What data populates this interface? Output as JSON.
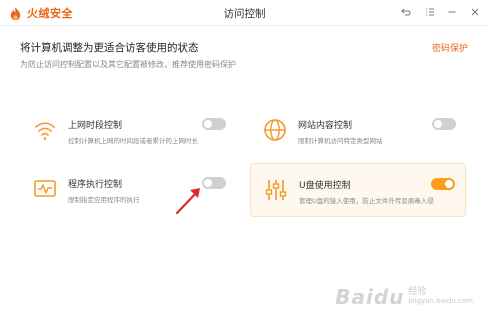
{
  "app": {
    "logo_text": "火绒安全",
    "window_title": "访问控制"
  },
  "header": {
    "title": "将计算机调整为更适合访客使用的状态",
    "subtitle": "为防止访问控制配置以及其它配置被修改，推荐使用密码保护",
    "password_link": "密码保护"
  },
  "cards": [
    {
      "title": "上网时段控制",
      "desc": "控制计算机上网的时间段或者累计的上网时长",
      "icon": "wifi-icon",
      "enabled": false
    },
    {
      "title": "网站内容控制",
      "desc": "限制计算机访问特定类型网站",
      "icon": "globe-icon",
      "enabled": false
    },
    {
      "title": "程序执行控制",
      "desc": "限制指定应用程序的执行",
      "icon": "program-monitor-icon",
      "enabled": false
    },
    {
      "title": "U盘使用控制",
      "desc": "管理U盘的接入使用，防止文件外传及病毒入侵",
      "icon": "sliders-icon",
      "enabled": true
    }
  ],
  "watermark": {
    "main": "Baidu",
    "sub": "经验",
    "sub2": "jingyan.baidu.com"
  },
  "colors": {
    "accent": "#ff9c1a",
    "brand": "#e8661b",
    "toggle_off": "#d0d0d0",
    "arrow": "#e0282e"
  }
}
